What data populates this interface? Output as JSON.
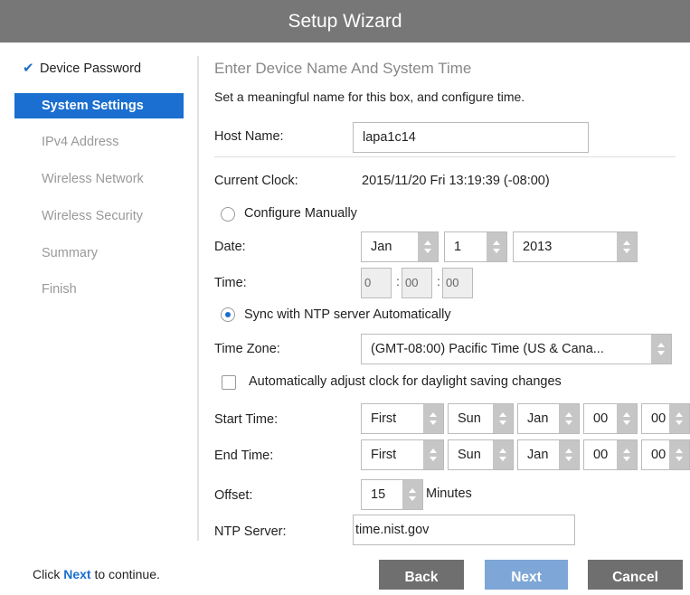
{
  "title": "Setup Wizard",
  "nav": {
    "items": [
      {
        "label": "Device Password"
      },
      {
        "label": "System Settings"
      },
      {
        "label": "IPv4 Address"
      },
      {
        "label": "Wireless Network"
      },
      {
        "label": "Wireless Security"
      },
      {
        "label": "Summary"
      },
      {
        "label": "Finish"
      }
    ],
    "check_icon": "checkmark-icon"
  },
  "main": {
    "heading": "Enter Device Name And System Time",
    "subtext": "Set a meaningful name for this box, and configure time.",
    "host_name_label": "Host Name:",
    "host_name_value": "lapa1c14",
    "current_clock_label": "Current Clock:",
    "current_clock_value": "2015/11/20 Fri 13:19:39 (-08:00)",
    "configure_manually_label": "Configure Manually",
    "date_label": "Date:",
    "date_month": "Jan",
    "date_day": "1",
    "date_year": "2013",
    "time_label": "Time:",
    "time_hour": "0",
    "time_minute": "00",
    "time_second": "00",
    "sync_ntp_label": "Sync with NTP server Automatically",
    "timezone_label": "Time Zone:",
    "timezone_value": "(GMT-08:00) Pacific Time (US & Cana...",
    "dst_label": "Automatically adjust clock for daylight saving changes",
    "start_time_label": "Start Time:",
    "start_time": [
      "First",
      "Sun",
      "Jan",
      "00",
      "00"
    ],
    "end_time_label": "End Time:",
    "end_time": [
      "First",
      "Sun",
      "Jan",
      "00",
      "00"
    ],
    "offset_label": "Offset:",
    "offset_value": "15",
    "offset_unit": "Minutes",
    "ntp_server_label": "NTP Server:",
    "ntp_server_value": "time.nist.gov",
    "configure_manually_selected": false,
    "sync_ntp_selected": true,
    "dst_checked": false
  },
  "footer": {
    "hint_prefix": "Click",
    "hint_link": "Next",
    "hint_suffix": "to continue.",
    "back_label": "Back",
    "next_label": "Next",
    "cancel_label": "Cancel"
  },
  "colors": {
    "accent": "#1a6fd0",
    "titlebar": "#777777",
    "button_gray": "#6f6f6f",
    "button_blue": "#7ea6d6"
  }
}
